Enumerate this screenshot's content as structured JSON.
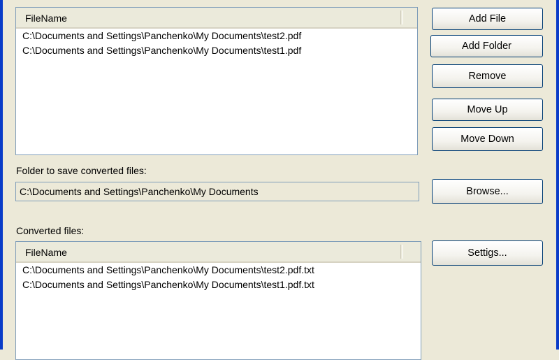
{
  "source_list": {
    "header": "FileName",
    "rows": [
      "C:\\Documents and Settings\\Panchenko\\My Documents\\test2.pdf",
      "C:\\Documents and Settings\\Panchenko\\My Documents\\test1.pdf"
    ]
  },
  "buttons": {
    "add_file": "Add File",
    "add_folder": "Add Folder",
    "remove": "Remove",
    "move_up": "Move Up",
    "move_down": "Move Down",
    "browse": "Browse...",
    "settings": "Settigs..."
  },
  "output_folder": {
    "label": "Folder to save converted files:",
    "value": "C:\\Documents and Settings\\Panchenko\\My Documents"
  },
  "converted_list": {
    "label": "Converted files:",
    "header": "FileName",
    "rows": [
      "C:\\Documents and Settings\\Panchenko\\My Documents\\test2.pdf.txt",
      "C:\\Documents and Settings\\Panchenko\\My Documents\\test1.pdf.txt"
    ]
  }
}
